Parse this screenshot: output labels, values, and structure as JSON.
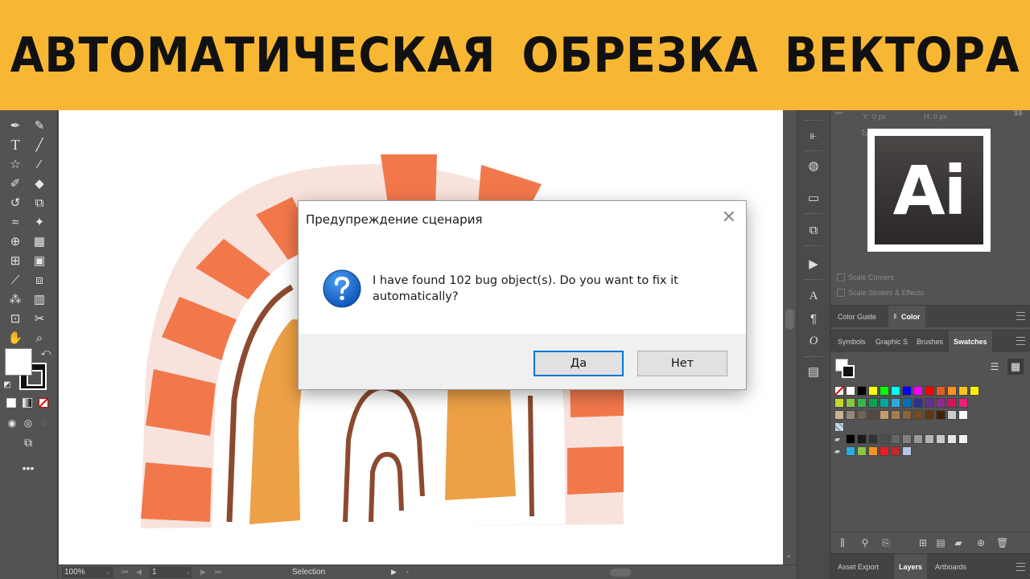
{
  "banner": {
    "title": "АВТОМАТИЧЕСКАЯ  ОБРЕЗКА  ВЕКТОРА"
  },
  "logo": {
    "text": "Ai"
  },
  "dialog": {
    "title": "Предупреждение сценария",
    "close_glyph": "✕",
    "icon": "question-icon",
    "message": "I have found 102 bug object(s). Do you want to fix it automatically?",
    "yes_label": "Да",
    "no_label": "Нет"
  },
  "statusbar": {
    "zoom": "100%",
    "page": "1",
    "tool": "Selection"
  },
  "transform_panel": {
    "y_label": "Y:",
    "y_value": "0 px",
    "h_label": "H:",
    "h_value": "0 px",
    "scale_corners": "Scale Corners",
    "scale_strokes": "Scale Strokes & Effects"
  },
  "panels": {
    "color_tabs": [
      "Color Guide",
      "Color"
    ],
    "swatch_tabs": [
      "Symbols",
      "Graphic S",
      "Brushes",
      "Swatches"
    ],
    "bottom_tabs": [
      "Asset Export",
      "Layers",
      "Artboards"
    ]
  },
  "swatches": {
    "row1": [
      "#ffffff",
      "#000000",
      "#ffff00",
      "#00ff00",
      "#00ffff",
      "#0000ff",
      "#ff00ff",
      "#ff0000",
      "#e85a24",
      "#f7941d",
      "#f9c31a",
      "#fff200"
    ],
    "row2": [
      "#c6d92e",
      "#8cc63f",
      "#39b54a",
      "#00a651",
      "#00a99d",
      "#29abe2",
      "#0071bc",
      "#2e3192",
      "#662d91",
      "#93278f",
      "#d4145a",
      "#ed1e79"
    ],
    "row3": [
      "#c7b299",
      "#998675",
      "#736357",
      "#534741",
      "#c69c6d",
      "#a67c52",
      "#8c6239",
      "#754c24",
      "#603813",
      "#42210b",
      "#cccccc",
      "#ffffff"
    ],
    "row4": [
      "#000000",
      "#1a1a1a",
      "#333333",
      "#4d4d4d",
      "#666666",
      "#808080",
      "#999999",
      "#b3b3b3",
      "#cccccc",
      "#e6e6e6",
      "#f2f2f2"
    ],
    "row5": [
      "#29abe2",
      "#8cc63f",
      "#f7931e",
      "#ed1c24",
      "#c1272d",
      "#b3c6e7"
    ]
  }
}
